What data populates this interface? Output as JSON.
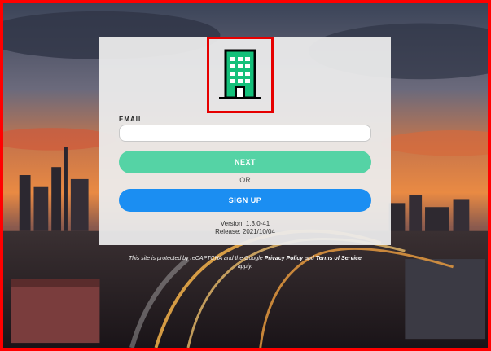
{
  "logo": {
    "icon": "office-building-icon",
    "color": "#14c07a"
  },
  "form": {
    "email_label": "EMAIL",
    "email_value": "",
    "next_label": "NEXT",
    "or_label": "OR",
    "signup_label": "SIGN UP"
  },
  "version": {
    "version_text": "Version: 1.3.0-41",
    "release_text": "Release: 2021/10/04"
  },
  "footer": {
    "recaptcha_prefix": "This site is protected by reCAPTCHA and the Google",
    "privacy_link": "Privacy Policy",
    "and_text": "and",
    "terms_link": "Terms of Service",
    "suffix": "apply."
  },
  "colors": {
    "next_button": "#55d3a5",
    "signup_button": "#1b8ef2",
    "highlight_border": "#ff0000"
  }
}
